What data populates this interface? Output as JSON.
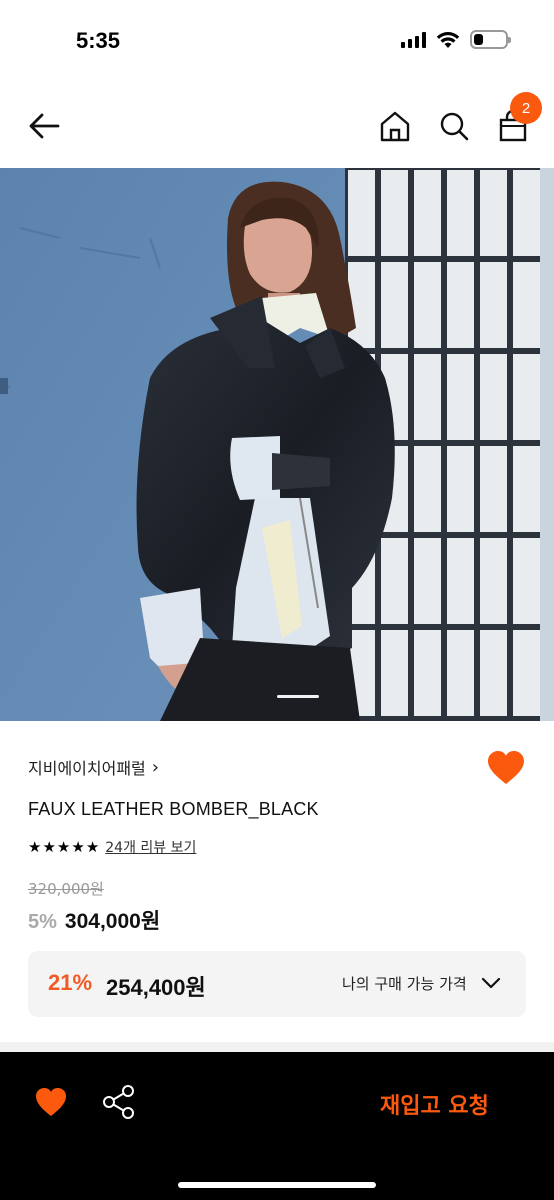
{
  "status_bar": {
    "time": "5:35"
  },
  "nav": {
    "back_icon": "arrow-left-icon",
    "home_icon": "home-icon",
    "search_icon": "search-icon",
    "cart_icon": "shopping-bag-icon",
    "cart_count": "2"
  },
  "hero": {
    "image_subject": "model wearing black faux leather bomber jacket against blue wall and white tiles",
    "carousel_position": 1
  },
  "product": {
    "brand": "지비에이치어패럴",
    "brand_chevron": "›",
    "title": "FAUX LEATHER BOMBER_BLACK",
    "rating_stars": 5,
    "stars": [
      "★",
      "★",
      "★",
      "★",
      "★"
    ],
    "review_link": "24개 리뷰 보기",
    "original_price": "320,000원",
    "discount": "5%",
    "price": "304,000원",
    "wishlisted": true
  },
  "my_price": {
    "discount": "21%",
    "amount": "254,400원",
    "label": "나의 구매 가능 가격"
  },
  "bottom_bar": {
    "restock_button": "재입고 요청",
    "heart_icon": "heart-icon",
    "share_icon": "share-icon"
  },
  "colors": {
    "accent": "#fb5a0e",
    "accent_text": "#f15a24",
    "bottom_bar_bg": "#000000",
    "price_box_bg": "#f4f4f5"
  }
}
